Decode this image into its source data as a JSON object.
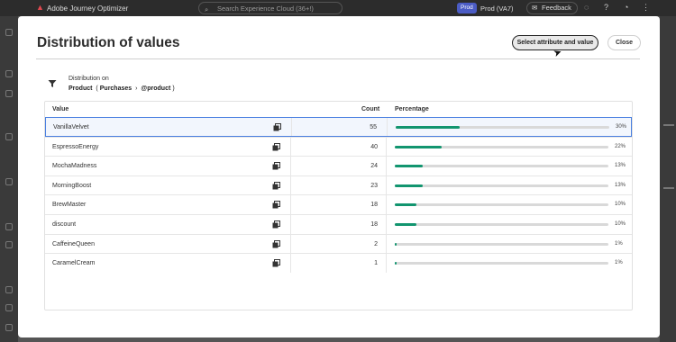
{
  "topbar": {
    "app_name": "Adobe Journey Optimizer",
    "search_placeholder": "Search Experience Cloud (36+!)",
    "prod_badge": "Prod",
    "env_label": "Prod (VA7)",
    "feedback_label": "Feedback"
  },
  "dialog": {
    "title": "Distribution of values",
    "primary_button": "Select attribute and value",
    "close_button": "Close",
    "distribution_label": "Distribution on",
    "path_root": "Product",
    "path_paren_open": "(",
    "path_mid": "Purchases",
    "path_sep": "›",
    "path_leaf": "@product",
    "path_paren_close": ")"
  },
  "table": {
    "headers": {
      "value": "Value",
      "count": "Count",
      "percentage": "Percentage"
    },
    "rows": [
      {
        "value": "VanillaVelvet",
        "count": "55",
        "percentage": "30%",
        "fraction": 0.3
      },
      {
        "value": "EspressoEnergy",
        "count": "40",
        "percentage": "22%",
        "fraction": 0.22
      },
      {
        "value": "MochaMadness",
        "count": "24",
        "percentage": "13%",
        "fraction": 0.13
      },
      {
        "value": "MorningBoost",
        "count": "23",
        "percentage": "13%",
        "fraction": 0.13
      },
      {
        "value": "BrewMaster",
        "count": "18",
        "percentage": "10%",
        "fraction": 0.1
      },
      {
        "value": "discount",
        "count": "18",
        "percentage": "10%",
        "fraction": 0.1
      },
      {
        "value": "CaffeineQueen",
        "count": "2",
        "percentage": "1%",
        "fraction": 0.01
      },
      {
        "value": "CaramelCream",
        "count": "1",
        "percentage": "1%",
        "fraction": 0.01
      }
    ]
  },
  "colors": {
    "accent": "#12956f",
    "selected_border": "#4a7fe0"
  }
}
